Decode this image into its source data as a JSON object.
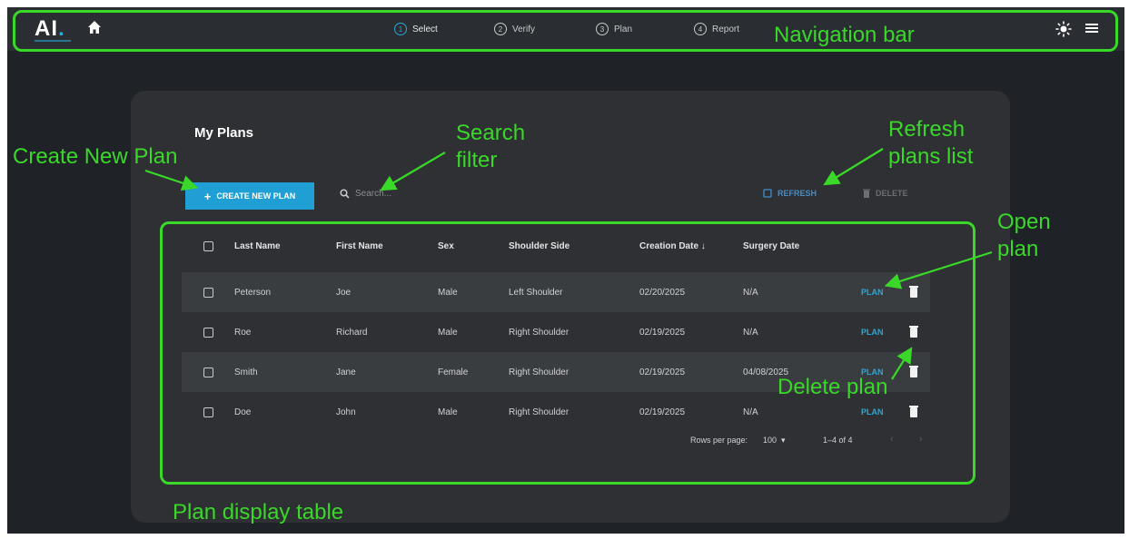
{
  "nav": {
    "logo": "AI",
    "steps": [
      {
        "num": "1",
        "label": "Select",
        "active": true
      },
      {
        "num": "2",
        "label": "Verify",
        "active": false
      },
      {
        "num": "3",
        "label": "Plan",
        "active": false
      },
      {
        "num": "4",
        "label": "Report",
        "active": false
      }
    ]
  },
  "page": {
    "title": "My Plans",
    "create_button": "CREATE NEW PLAN",
    "search_placeholder": "Search...",
    "refresh_button": "REFRESH",
    "delete_button": "DELETE"
  },
  "table": {
    "columns": [
      "Last Name",
      "First Name",
      "Sex",
      "Shoulder Side",
      "Creation Date ↓",
      "Surgery Date"
    ],
    "rows": [
      {
        "last": "Peterson",
        "first": "Joe",
        "sex": "Male",
        "side": "Left Shoulder",
        "created": "02/20/2025",
        "surgery": "N/A",
        "action": "PLAN"
      },
      {
        "last": "Roe",
        "first": "Richard",
        "sex": "Male",
        "side": "Right Shoulder",
        "created": "02/19/2025",
        "surgery": "N/A",
        "action": "PLAN"
      },
      {
        "last": "Smith",
        "first": "Jane",
        "sex": "Female",
        "side": "Right Shoulder",
        "created": "02/19/2025",
        "surgery": "04/08/2025",
        "action": "PLAN"
      },
      {
        "last": "Doe",
        "first": "John",
        "sex": "Male",
        "side": "Right Shoulder",
        "created": "02/19/2025",
        "surgery": "N/A",
        "action": "PLAN"
      }
    ],
    "rows_per_page_label": "Rows per page:",
    "rows_per_page_value": "100",
    "range": "1–4 of 4"
  },
  "annotations": {
    "navigation_bar": "Navigation bar",
    "create_new_plan": "Create New Plan",
    "search_filter": "Search\nfilter",
    "refresh_plans_list": "Refresh\nplans list",
    "open_plan": "Open\nplan",
    "delete_plan": "Delete plan",
    "plan_display_table": "Plan display table"
  },
  "colors": {
    "accent": "#1f9fd3",
    "annotation": "#39d829",
    "background": "#1f2226",
    "card": "#2e3033"
  }
}
